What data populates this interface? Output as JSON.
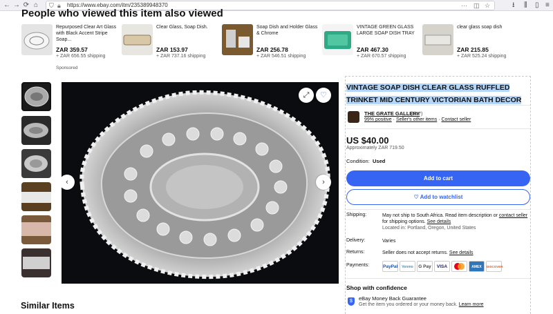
{
  "browser": {
    "url": "https://www.ebay.com/itm/235389948370",
    "colors": {
      "chrome_bg": "#f0f0f4"
    }
  },
  "recently_viewed": {
    "heading": "People who viewed this item also viewed",
    "items": [
      {
        "title": "Repurposed Clear Art Glass with Black Accent Stripe Soap...",
        "price": "ZAR 359.57",
        "shipping": "+ ZAR 656.55 shipping",
        "sponsored": "Sponsored"
      },
      {
        "title": "Clear Glass, Soap Dish.",
        "price": "ZAR 153.97",
        "shipping": "+ ZAR 737.16 shipping"
      },
      {
        "title": "Soap Dish and Holder Glass & Chrome",
        "price": "ZAR 256.78",
        "shipping": "+ ZAR 546.51 shipping"
      },
      {
        "title": "VINTAGE GREEN GLASS LARGE SOAP DISH TRAY",
        "price": "ZAR 467.30",
        "shipping": "+ ZAR 670.57 shipping"
      },
      {
        "title": "clear glass soap dish",
        "price": "ZAR 215.85",
        "shipping": "+ ZAR 525.24 shipping"
      }
    ]
  },
  "listing": {
    "title": "VINTAGE SOAP DISH CLEAR GLASS RUFFLED TRINKET MID CENTURY VICTORIAN BATH DECOR",
    "seller": {
      "name": "THE GRATE GALLERY",
      "count": "(547)",
      "positive": "99% positive",
      "other_items": "Seller's other items",
      "contact": "Contact seller"
    },
    "price": "US $40.00",
    "approx": "Approximately ZAR 719.50",
    "condition_label": "Condition:",
    "condition_value": "Used",
    "add_to_cart": "Add to cart",
    "add_to_watchlist": "Add to watchlist",
    "shipping_label": "Shipping:",
    "shipping_text": "May not ship to South Africa. Read item description or",
    "shipping_link1": "contact seller",
    "shipping_text2": "for shipping options.",
    "shipping_link2": "See details",
    "location": "Located in: Portland, Oregon, United States",
    "delivery_label": "Delivery:",
    "delivery_value": "Varies",
    "returns_label": "Returns:",
    "returns_value": "Seller does not accept returns.",
    "returns_link": "See details",
    "payments_label": "Payments:",
    "payment_methods": [
      "PayPal",
      "Venmo",
      "G Pay",
      "VISA",
      "Mastercard",
      "AMEX",
      "DISCOVER"
    ],
    "shop_heading": "Shop with confidence",
    "mbg_title": "eBay Money Back Guarantee",
    "mbg_sub": "Get the item you ordered or your money back.",
    "mbg_link": "Learn more",
    "colors": {
      "accent": "#3665f3",
      "title_highlight": "#b3d5f7"
    }
  },
  "similar_heading": "Similar Items"
}
